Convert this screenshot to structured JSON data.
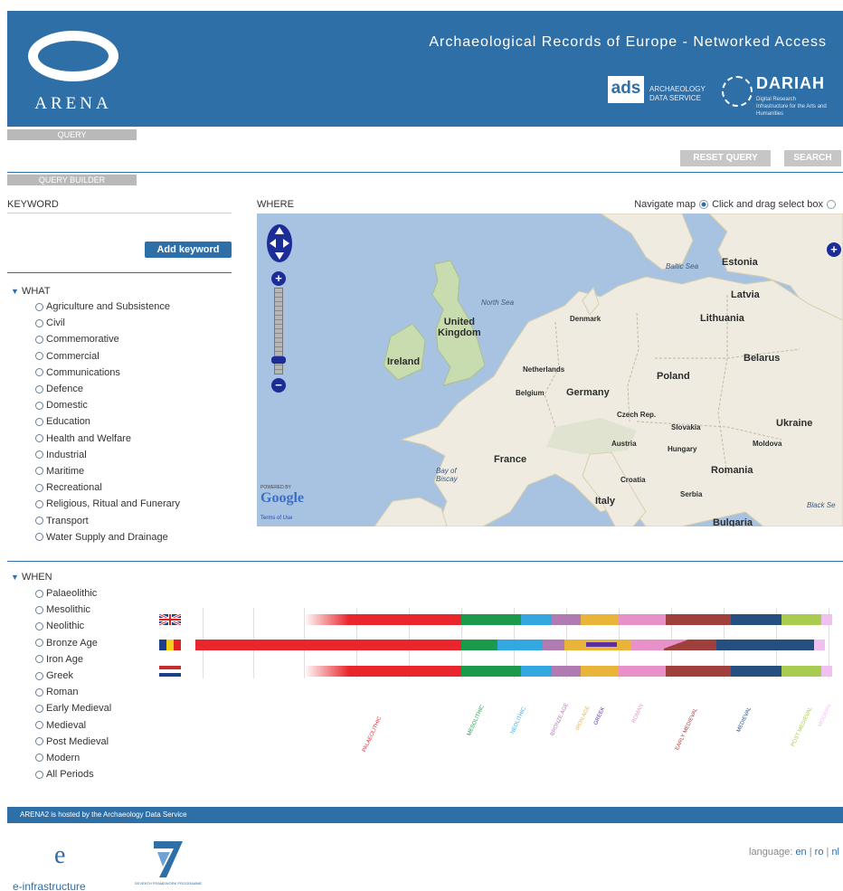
{
  "header": {
    "logo_text": "ARENA",
    "title": "Archaeological Records of Europe - Networked Access",
    "partners": {
      "ads_mark": "ads",
      "ads_name_1": "ARCHAEOLOGY",
      "ads_name_2": "DATA SERVICE",
      "dariah_name": "DARIAH",
      "dariah_sub": "Digital Research Infrastructure for the Arts and Humanities"
    }
  },
  "tabs": {
    "query": "QUERY",
    "query_builder": "QUERY BUILDER"
  },
  "actions": {
    "reset": "RESET QUERY",
    "search": "SEARCH"
  },
  "keyword": {
    "label": "KEYWORD",
    "value": "",
    "add_button": "Add keyword"
  },
  "what": {
    "label": "WHAT",
    "options": [
      " Agriculture and Subsistence",
      "Civil",
      "Commemorative",
      "Commercial",
      "Communications",
      "Defence",
      "Domestic",
      "Education",
      "Health and Welfare",
      "Industrial",
      "Maritime",
      "Recreational",
      "Religious, Ritual and Funerary",
      "Transport",
      "Water Supply and Drainage"
    ]
  },
  "where": {
    "label": "WHERE",
    "mode_navigate": "Navigate map",
    "mode_select": "Click and drag select box",
    "selected_mode": "navigate",
    "zoom_in": "+",
    "zoom_out": "−",
    "layers": "+",
    "powered_by": "POWERED BY",
    "provider": "Google",
    "terms": "Terms of Use"
  },
  "map_labels": {
    "estonia": "Estonia",
    "baltic_sea": "Baltic Sea",
    "latvia": "Latvia",
    "north_sea": "North Sea",
    "united_kingdom": "United\nKingdom",
    "denmark": "Denmark",
    "lithuania": "Lithuania",
    "ireland": "Ireland",
    "belarus": "Belarus",
    "netherlands": "Netherlands",
    "poland": "Poland",
    "belgium": "Belgium",
    "germany": "Germany",
    "czech_rep": "Czech Rep.",
    "ukraine": "Ukraine",
    "slovakia": "Slovakia",
    "austria": "Austria",
    "moldova": "Moldova",
    "hungary": "Hungary",
    "france": "France",
    "romania": "Romania",
    "bay_of_biscay": "Bay of\nBiscay",
    "croatia": "Croatia",
    "serbia": "Serbia",
    "italy": "Italy",
    "black_sea": "Black Se",
    "bulgaria": "Bulgaria"
  },
  "when": {
    "label": "WHEN",
    "options": [
      "Palaeolithic",
      "Mesolithic",
      "Neolithic",
      "Bronze Age",
      "Iron Age",
      "Greek",
      "Roman",
      "Early Medieval",
      "Medieval",
      "Post Medieval",
      "Modern",
      "All Periods"
    ]
  },
  "timeline": {
    "countries": [
      "United Kingdom",
      "Romania",
      "Netherlands"
    ],
    "colors": {
      "palaeolithic": "#e8262c",
      "mesolithic": "#1c9a4c",
      "neolithic": "#33a8e0",
      "bronze_age": "#b07ab2",
      "iron_age": "#e8b43a",
      "greek": "#5a2fa0",
      "roman": "#e890c8",
      "early_medieval": "#a0403c",
      "medieval": "#244f80",
      "post_medieval": "#a8cc50",
      "modern": "#f0c0f0"
    },
    "period_labels": [
      "PALAEOLITHIC",
      "MESOLITHIC",
      "NEOLITHIC",
      "BRONZE AGE",
      "IRON AGE",
      "GREEK",
      "ROMAN",
      "EARLY MEDIEVAL",
      "MEDIEVAL",
      "POST MEDIEVAL",
      "MODERN"
    ]
  },
  "footer": {
    "hosted": "ARENA2 is hosted by the Archaeology Data Service",
    "language_label": "language:",
    "languages": [
      "en",
      "ro",
      "nl"
    ],
    "sep": "|",
    "einfra": "e-infrastructure",
    "fp7_text": "SEVENTH FRAMEWORK PROGRAMME"
  }
}
